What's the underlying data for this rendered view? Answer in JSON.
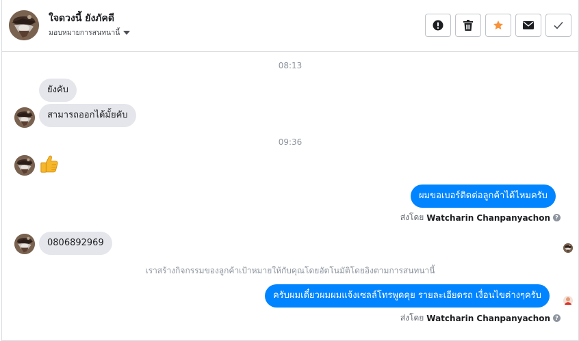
{
  "header": {
    "contact_name": "ใจดวงนี้ ยังภัคดี",
    "assign_label": "มอบหมายการสนทนานี้",
    "actions": [
      {
        "name": "mark-spam-button",
        "icon": "alert-circle-icon"
      },
      {
        "name": "delete-button",
        "icon": "trash-icon"
      },
      {
        "name": "star-button",
        "icon": "star-icon"
      },
      {
        "name": "mark-unread-button",
        "icon": "envelope-icon"
      },
      {
        "name": "mark-done-button",
        "icon": "check-icon"
      }
    ]
  },
  "conversation": {
    "timestamp_1": "08:13",
    "timestamp_2": "09:36",
    "messages": [
      {
        "direction": "incoming",
        "text": "ยังคับ"
      },
      {
        "direction": "incoming",
        "text": "สามารถออกได้มั้ยคับ"
      },
      {
        "direction": "incoming",
        "type": "sticker",
        "icon": "thumbs-up-icon"
      },
      {
        "direction": "outgoing",
        "text": "ผมขอเบอร์ติดต่อลูกค้าได้ไหมครับ",
        "sent_by_prefix": "ส่งโดย",
        "sent_by_name": "Watcharin Chanpanyachon"
      },
      {
        "direction": "incoming",
        "text": "0806892969"
      },
      {
        "direction": "outgoing",
        "text": "ครับผมเดี๋ยวผมผมแจ้งเซลล์โทรพูดคุย รายละเอียดรถ เงื่อนไขต่างๆครับ",
        "sent_by_prefix": "ส่งโดย",
        "sent_by_name": "Watcharin Chanpanyachon"
      }
    ],
    "system_note": "เราสร้างกิจกรรมของลูกค้าเป้าหมายให้กับคุณโดยอัตโนมัติโดยอิงตามการสนทนานี้"
  },
  "colors": {
    "outgoing_bubble": "#0084ff",
    "incoming_bubble": "#e4e6eb",
    "star": "#f7923b"
  }
}
